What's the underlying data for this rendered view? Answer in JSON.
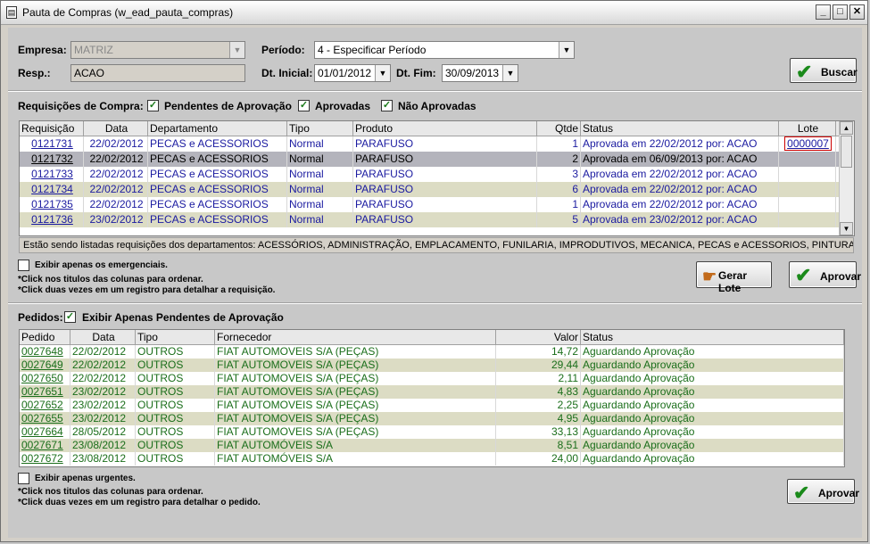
{
  "window": {
    "title": "Pauta de Compras (w_ead_pauta_compras)",
    "controls": {
      "minimize": "_",
      "maximize": "□",
      "close": "✕"
    }
  },
  "filters": {
    "empresa_label": "Empresa:",
    "empresa_value": "MATRIZ",
    "resp_label": "Resp.:",
    "resp_value": "ACAO",
    "periodo_label": "Período:",
    "periodo_value": "4 - Especificar Período",
    "dt_inicial_label": "Dt. Inicial:",
    "dt_inicial_value": "01/01/2012",
    "dt_fim_label": "Dt. Fim:",
    "dt_fim_value": "30/09/2013",
    "buscar_label": "Buscar"
  },
  "requisicoes": {
    "section_label": "Requisições de Compra:",
    "chk_pendentes": "Pendentes de Aprovação",
    "chk_aprovadas": "Aprovadas",
    "chk_nao_aprovadas": "Não Aprovadas",
    "columns": [
      "Requisição",
      "Data",
      "Departamento",
      "Tipo",
      "Produto",
      "Qtde",
      "Status",
      "Lote"
    ],
    "rows": [
      {
        "req": "0121731",
        "data": "22/02/2012",
        "dep": "PECAS e ACESSORIOS",
        "tipo": "Normal",
        "produto": "PARAFUSO",
        "qtde": "1",
        "status": "Aprovada em 22/02/2012 por: ACAO",
        "lote": "0000007"
      },
      {
        "req": "0121732",
        "data": "22/02/2012",
        "dep": "PECAS e ACESSORIOS",
        "tipo": "Normal",
        "produto": "PARAFUSO",
        "qtde": "2",
        "status": "Aprovada em 06/09/2013 por: ACAO",
        "lote": ""
      },
      {
        "req": "0121733",
        "data": "22/02/2012",
        "dep": "PECAS e ACESSORIOS",
        "tipo": "Normal",
        "produto": "PARAFUSO",
        "qtde": "3",
        "status": "Aprovada em 22/02/2012 por: ACAO",
        "lote": ""
      },
      {
        "req": "0121734",
        "data": "22/02/2012",
        "dep": "PECAS e ACESSORIOS",
        "tipo": "Normal",
        "produto": "PARAFUSO",
        "qtde": "6",
        "status": "Aprovada em 22/02/2012 por: ACAO",
        "lote": ""
      },
      {
        "req": "0121735",
        "data": "22/02/2012",
        "dep": "PECAS e ACESSORIOS",
        "tipo": "Normal",
        "produto": "PARAFUSO",
        "qtde": "1",
        "status": "Aprovada em 22/02/2012 por: ACAO",
        "lote": ""
      },
      {
        "req": "0121736",
        "data": "23/02/2012",
        "dep": "PECAS e ACESSORIOS",
        "tipo": "Normal",
        "produto": "PARAFUSO",
        "qtde": "5",
        "status": "Aprovada em 23/02/2012 por: ACAO",
        "lote": ""
      }
    ],
    "info_bar": "Estão sendo listadas requisições dos departamentos: ACESSÓRIOS, ADMINISTRAÇÃO, EMPLACAMENTO, FUNILARIA, IMPRODUTIVOS, MECANICA, PECAS e ACESSORIOS, PINTURA, ASSISTÊNC",
    "chk_emergenciais": "Exibir apenas os emergenciais.",
    "hint1": "*Click nos titulos das colunas para ordenar.",
    "hint2": "*Click duas vezes em um registro para detalhar a requisição.",
    "gerar_lote_label": "Gerar Lote",
    "aprovar_label": "Aprovar"
  },
  "pedidos": {
    "section_label": "Pedidos:",
    "chk_pendentes": "Exibir Apenas Pendentes de Aprovação",
    "columns": [
      "Pedido",
      "Data",
      "Tipo",
      "Fornecedor",
      "Valor",
      "Status"
    ],
    "rows": [
      {
        "pedido": "0027648",
        "data": "22/02/2012",
        "tipo": "OUTROS",
        "fornecedor": "FIAT AUTOMOVEIS S/A (PEÇAS)",
        "valor": "14,72",
        "status": "Aguardando Aprovação"
      },
      {
        "pedido": "0027649",
        "data": "22/02/2012",
        "tipo": "OUTROS",
        "fornecedor": "FIAT AUTOMOVEIS S/A (PEÇAS)",
        "valor": "29,44",
        "status": "Aguardando Aprovação"
      },
      {
        "pedido": "0027650",
        "data": "22/02/2012",
        "tipo": "OUTROS",
        "fornecedor": "FIAT AUTOMOVEIS S/A (PEÇAS)",
        "valor": "2,11",
        "status": "Aguardando Aprovação"
      },
      {
        "pedido": "0027651",
        "data": "23/02/2012",
        "tipo": "OUTROS",
        "fornecedor": "FIAT AUTOMOVEIS S/A (PEÇAS)",
        "valor": "4,83",
        "status": "Aguardando Aprovação"
      },
      {
        "pedido": "0027652",
        "data": "23/02/2012",
        "tipo": "OUTROS",
        "fornecedor": "FIAT AUTOMOVEIS S/A (PEÇAS)",
        "valor": "2,25",
        "status": "Aguardando Aprovação"
      },
      {
        "pedido": "0027655",
        "data": "23/02/2012",
        "tipo": "OUTROS",
        "fornecedor": "FIAT AUTOMOVEIS S/A (PEÇAS)",
        "valor": "4,95",
        "status": "Aguardando Aprovação"
      },
      {
        "pedido": "0027664",
        "data": "28/05/2012",
        "tipo": "OUTROS",
        "fornecedor": "FIAT AUTOMOVEIS S/A (PEÇAS)",
        "valor": "33,13",
        "status": "Aguardando Aprovação"
      },
      {
        "pedido": "0027671",
        "data": "23/08/2012",
        "tipo": "OUTROS",
        "fornecedor": "FIAT AUTOMÓVEIS S/A",
        "valor": "8,51",
        "status": "Aguardando Aprovação"
      },
      {
        "pedido": "0027672",
        "data": "23/08/2012",
        "tipo": "OUTROS",
        "fornecedor": "FIAT AUTOMÓVEIS S/A",
        "valor": "24,00",
        "status": "Aguardando Aprovação"
      }
    ],
    "chk_urgentes": "Exibir apenas urgentes.",
    "hint1": "*Click nos titulos das colunas para ordenar.",
    "hint2": "*Click duas vezes em um registro para detalhar o pedido.",
    "aprovar_label": "Aprovar"
  },
  "colors": {
    "row_alt": "#dcdcc4",
    "row_selected": "#b4b4bc",
    "req_text": "#1a1aa0",
    "ped_text": "#1a6e1a",
    "check_green": "#1a8a1a"
  }
}
